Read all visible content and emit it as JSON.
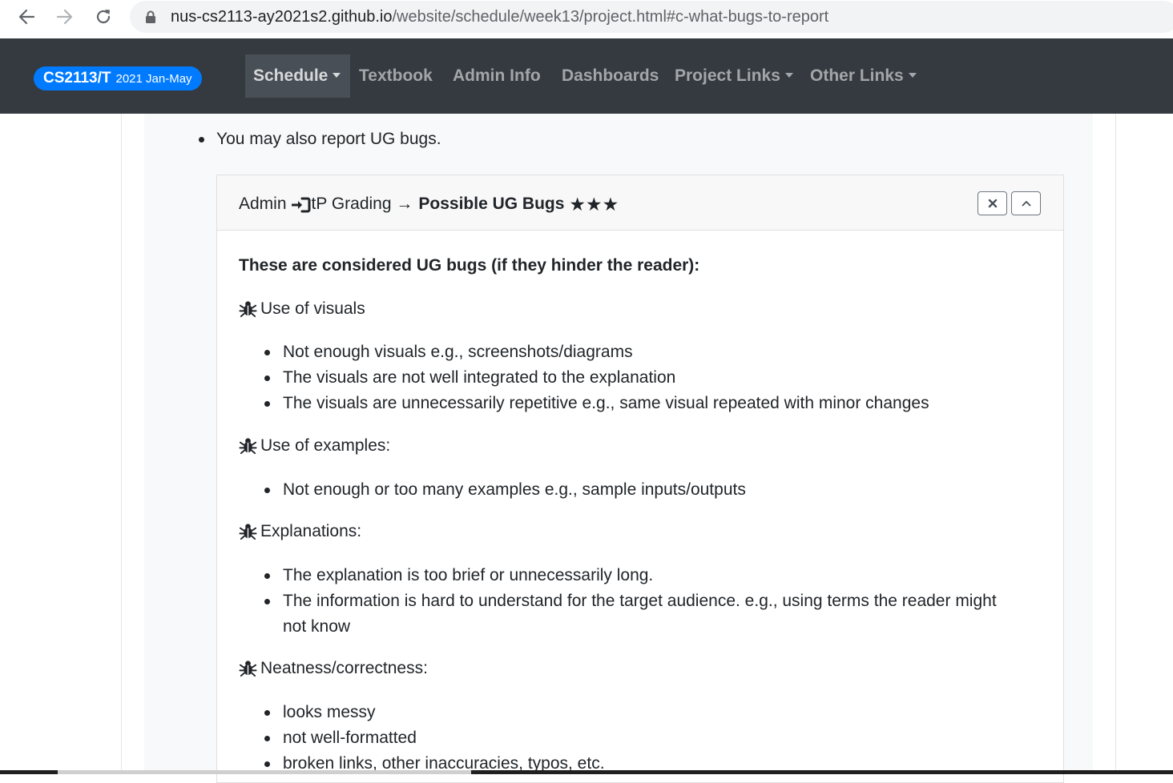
{
  "browser": {
    "url_host": "nus-cs2113-ay2021s2.github.io",
    "url_path": "/website/schedule/week13/project.html#c-what-bugs-to-report",
    "back_icon": "arrow-left-icon",
    "forward_icon": "arrow-right-icon",
    "reload_icon": "reload-icon",
    "lock_icon": "lock-icon"
  },
  "navbar": {
    "brand_main": "CS2113/T",
    "brand_sub": "2021 Jan-May",
    "brand_color": "#007bff",
    "background": "#343a40",
    "items": [
      {
        "label": "Schedule",
        "dropdown": true,
        "active": true
      },
      {
        "label": "Textbook",
        "dropdown": false
      },
      {
        "label": "Admin Info",
        "dropdown": false
      },
      {
        "label": "Dashboards",
        "dropdown": false
      },
      {
        "label": "Project Links",
        "dropdown": true
      },
      {
        "label": "Other Links",
        "dropdown": true
      }
    ]
  },
  "content": {
    "intro_bullet": "You may also report UG bugs.",
    "panel": {
      "breadcrumb_start": "Admin",
      "breadcrumb_middle": "tP Grading →",
      "title": "Possible UG Bugs",
      "stars": "★★★",
      "close_icon": "close-icon",
      "collapse_icon": "chevron-up-icon",
      "heading": "These are considered UG bugs (if they hinder the reader):",
      "sections": [
        {
          "title": "Use of visuals",
          "items": [
            "Not enough visuals e.g., screenshots/diagrams",
            "The visuals are not well integrated to the explanation",
            "The visuals are unnecessarily repetitive e.g., same visual repeated with minor changes"
          ]
        },
        {
          "title": "Use of examples:",
          "items": [
            "Not enough or too many examples e.g., sample inputs/outputs"
          ]
        },
        {
          "title": "Explanations:",
          "items": [
            "The explanation is too brief or unnecessarily long.",
            "The information is hard to understand for the target audience. e.g., using terms the reader might",
            "not know"
          ]
        },
        {
          "title": "Neatness/correctness:",
          "items": [
            "looks messy",
            "not well-formatted",
            "broken links, other inaccuracies, typos, etc."
          ]
        }
      ]
    }
  }
}
